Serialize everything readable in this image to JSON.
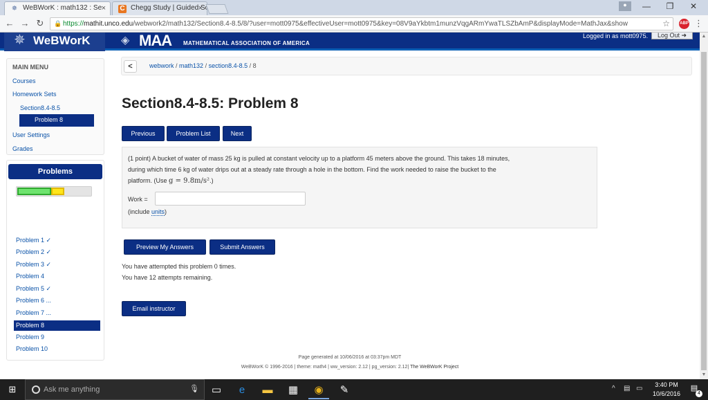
{
  "browser": {
    "tabs": [
      {
        "title": "WeBWorK : math132 : Se",
        "icon": "webwork-star-icon"
      },
      {
        "title": "Chegg Study | Guided So",
        "icon": "chegg-c-icon"
      }
    ],
    "url_scheme": "https://",
    "url_host": "mathit.unco.edu",
    "url_path": "/webwork2/math132/Section8.4-8.5/8/?user=mott0975&effectiveUser=mott0975&key=08V9aYkbtm1munzVqgARmYwaTLSZbAmP&displayMode=MathJax&show"
  },
  "header": {
    "logo_text": "WeBWorK",
    "maa_text": "MAA",
    "maa_subtitle": "MATHEMATICAL ASSOCIATION OF AMERICA",
    "logged_in_text": "Logged in as mott0975.",
    "logout_label": "Log Out"
  },
  "main_menu": {
    "title": "MAIN MENU",
    "courses": "Courses",
    "homework_sets": "Homework Sets",
    "section": "Section8.4-8.5",
    "problem": "Problem 8",
    "user_settings": "User Settings",
    "grades": "Grades"
  },
  "problems_panel": {
    "title": "Problems",
    "progress_correct": 0.45,
    "progress_partial": 0.18,
    "items": [
      {
        "label": "Problem 1 ✓"
      },
      {
        "label": "Problem 2 ✓"
      },
      {
        "label": "Problem 3 ✓"
      },
      {
        "label": "Problem 4"
      },
      {
        "label": "Problem 5 ✓"
      },
      {
        "label": "Problem 6 ..."
      },
      {
        "label": "Problem 7 ..."
      },
      {
        "label": "Problem 8"
      },
      {
        "label": "Problem 9"
      },
      {
        "label": "Problem 10"
      }
    ]
  },
  "breadcrumb": {
    "back": "<",
    "part1": "webwork",
    "sep": " / ",
    "part2": "math132",
    "part3": "section8.4-8.5",
    "part4": "8"
  },
  "page_title": "Section8.4-8.5: Problem 8",
  "nav_buttons": {
    "previous": "Previous",
    "problem_list": "Problem List",
    "next": "Next"
  },
  "problem": {
    "line1": "(1 point) A bucket of water of mass 25 kg is pulled at constant velocity up to a platform 45 meters above the ground. This takes 18 minutes,",
    "line2": "during which time 6 kg of water drips out at a steady rate through a hole in the bottom. Find the work needed to raise the bucket to the",
    "line3_pre": "platform. (Use ",
    "line3_math": "g = 9.8m/s²",
    "line3_post": ".)",
    "work_label": "Work =",
    "work_value": "",
    "include_pre": "(include ",
    "include_link": "units",
    "include_post": ")"
  },
  "actions": {
    "preview": "Preview My Answers",
    "submit": "Submit Answers",
    "email": "Email instructor"
  },
  "attempts": {
    "line1": "You have attempted this problem 0 times.",
    "line2": "You have 12 attempts remaining."
  },
  "footer": {
    "generated": "Page generated at 10/06/2016 at 03:37pm MDT",
    "copyright": "WeBWorK © 1996-2016 | theme: math4 | ww_version: 2.12 | pg_version: 2.12|",
    "project": "The WeBWorK Project"
  },
  "taskbar": {
    "search_placeholder": "Ask me anything",
    "time": "3:40 PM",
    "date": "10/6/2016",
    "notification_count": "4"
  },
  "colors": {
    "header_blue": "#0b2e84",
    "link_blue": "#0a52a8",
    "progress_green": "#6ee36e",
    "progress_yellow": "#ffe61a"
  }
}
